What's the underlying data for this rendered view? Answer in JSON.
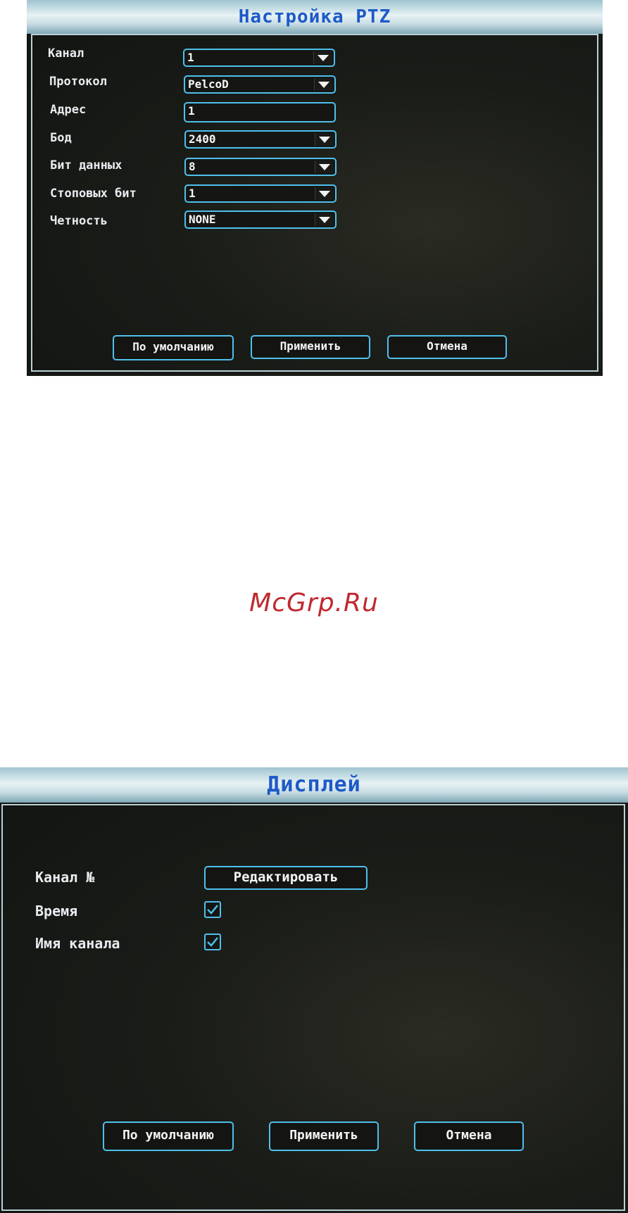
{
  "ptz": {
    "title": "Настройка PTZ",
    "rows": [
      {
        "label": "Канал",
        "value": "1",
        "dropdown": true
      },
      {
        "label": "Протокол",
        "value": "PelcoD",
        "dropdown": true
      },
      {
        "label": "Адрес",
        "value": "1",
        "dropdown": false
      },
      {
        "label": "Бод",
        "value": "2400",
        "dropdown": true
      },
      {
        "label": "Бит данных",
        "value": "8",
        "dropdown": true
      },
      {
        "label": "Стоповых бит",
        "value": "1",
        "dropdown": true
      },
      {
        "label": "Четность",
        "value": "NONE",
        "dropdown": true
      }
    ],
    "buttons": {
      "default": "По умолчанию",
      "apply": "Применить",
      "cancel": "Отмена"
    }
  },
  "watermark": "McGrp.Ru",
  "display": {
    "title": "Дисплей",
    "channel_label": "Канал №",
    "edit_button": "Редактировать",
    "time_label": "Время",
    "time_checked": true,
    "channel_name_label": "Имя канала",
    "channel_name_checked": true,
    "buttons": {
      "default": "По умолчанию",
      "apply": "Применить",
      "cancel": "Отмена"
    }
  },
  "colors": {
    "title_text": "#1d59c8",
    "accent_border": "#4fc0ec",
    "watermark": "#c0282f"
  },
  "icons": [
    "chevron-down-icon",
    "checkmark-icon"
  ]
}
